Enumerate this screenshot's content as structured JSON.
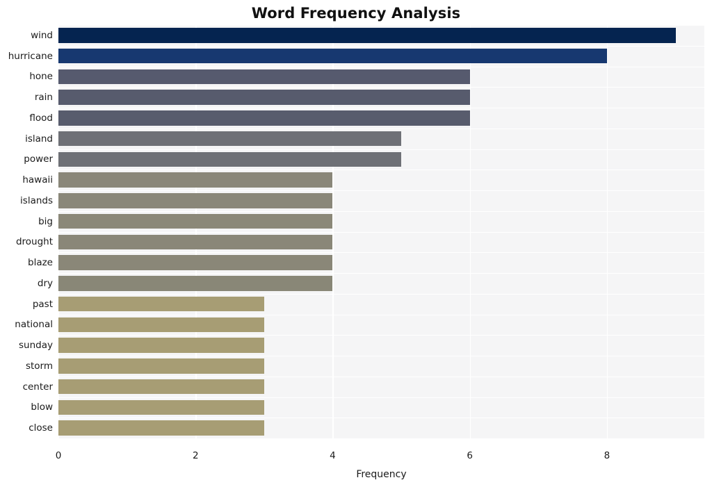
{
  "chart_data": {
    "type": "bar",
    "orientation": "horizontal",
    "title": "Word Frequency Analysis",
    "xlabel": "Frequency",
    "ylabel": "",
    "categories": [
      "wind",
      "hurricane",
      "hone",
      "rain",
      "flood",
      "island",
      "power",
      "hawaii",
      "islands",
      "big",
      "drought",
      "blaze",
      "dry",
      "past",
      "national",
      "sunday",
      "storm",
      "center",
      "blow",
      "close"
    ],
    "values": [
      9,
      8,
      6,
      6,
      6,
      5,
      5,
      4,
      4,
      4,
      4,
      4,
      4,
      3,
      3,
      3,
      3,
      3,
      3,
      3
    ],
    "bar_colors": [
      "#052450",
      "#173870",
      "#565a6e",
      "#575b6d",
      "#585c6d",
      "#6e7076",
      "#6e7076",
      "#8a8779",
      "#8a8779",
      "#8b8878",
      "#8a8778",
      "#8a8778",
      "#898777",
      "#a79d74",
      "#a79d74",
      "#a79d74",
      "#a79d74",
      "#a79d74",
      "#a79d74",
      "#a79d74"
    ],
    "x_ticks": [
      0,
      2,
      4,
      6,
      8
    ],
    "x_tick_labels": [
      "0",
      "2",
      "4",
      "6",
      "8"
    ],
    "xlim": [
      0,
      9.42
    ],
    "grid": true,
    "legend": "none",
    "plot_background": "#f5f5f6",
    "gridline_color": "#ffffff",
    "figure_background": "#ffffff",
    "text_color": "#1a1a1a"
  }
}
